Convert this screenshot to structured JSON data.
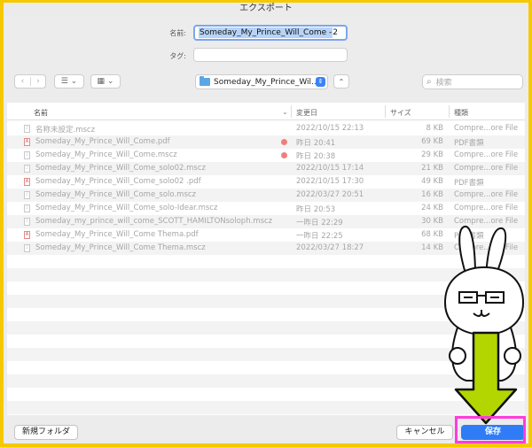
{
  "dialog": {
    "title": "エクスポート",
    "name_label": "名前:",
    "name_value": "Someday_My_Prince_Will_Come - ",
    "name_tail": "2",
    "tag_label": "タグ:",
    "location": "Someday_My_Prince_Wil...",
    "search_placeholder": "検索"
  },
  "toolbar": {
    "back_glyph": "‹",
    "forward_glyph": "›",
    "list_view_glyph": "☰ ⌄",
    "grid_view_glyph": "▦ ⌄",
    "expand_glyph": "⌃",
    "search_glyph": "⌕",
    "updown_glyph": "⇕"
  },
  "columns": {
    "name": "名前",
    "date": "変更日",
    "size": "サイズ",
    "kind": "種類",
    "chevron": "⌄"
  },
  "files": [
    {
      "icon": "score-file-icon",
      "name": "名称未設定.mscz",
      "date": "2022/10/15 22:13",
      "size": "8 KB",
      "kind": "Compre...ore File",
      "tag": false
    },
    {
      "icon": "pdf-file-icon",
      "name": "Someday_My_Prince_Will_Come.pdf",
      "date": "昨日 20:41",
      "size": "69 KB",
      "kind": "PDF書類",
      "tag": true
    },
    {
      "icon": "score-file-icon",
      "name": "Someday_My_Prince_Will_Come.mscz",
      "date": "昨日 20:38",
      "size": "29 KB",
      "kind": "Compre...ore File",
      "tag": true
    },
    {
      "icon": "score-file-icon",
      "name": "Someday_My_Prince_Will_Come_solo02.mscz",
      "date": "2022/10/15 17:14",
      "size": "21 KB",
      "kind": "Compre...ore File",
      "tag": false
    },
    {
      "icon": "pdf-file-icon",
      "name": "Someday_My_Prince_Will_Come_solo02 .pdf",
      "date": "2022/10/15 17:30",
      "size": "49 KB",
      "kind": "PDF書類",
      "tag": false
    },
    {
      "icon": "score-file-icon",
      "name": "Someday_My_Prince_Will_Come_solo.mscz",
      "date": "2022/03/27 20:51",
      "size": "16 KB",
      "kind": "Compre...ore File",
      "tag": false
    },
    {
      "icon": "score-file-icon",
      "name": "Someday_My_Prince_Will_Come_solo-Idear.mscz",
      "date": "昨日 20:53",
      "size": "24 KB",
      "kind": "Compre...ore File",
      "tag": false
    },
    {
      "icon": "score-file-icon",
      "name": "Someday_my_prince_will_come_SCOTT_HAMILTONsoloph.mscz",
      "date": "一昨日 22:29",
      "size": "30 KB",
      "kind": "Compre...ore File",
      "tag": false
    },
    {
      "icon": "pdf-file-icon",
      "name": "Someday_My_Prince_Will_Come Thema.pdf",
      "date": "一昨日 22:25",
      "size": "68 KB",
      "kind": "PDF書類",
      "tag": false
    },
    {
      "icon": "score-file-icon",
      "name": "Someday_My_Prince_Will_Come Thema.mscz",
      "date": "2022/03/27 18:27",
      "size": "14 KB",
      "kind": "Compre...ore File",
      "tag": false
    }
  ],
  "buttons": {
    "new_folder": "新規フォルダ",
    "cancel": "キャンセル",
    "save": "保存"
  },
  "colors": {
    "frame": "#f5c800",
    "highlight": "#ff3cdc",
    "accent": "#2f7cf6",
    "arrow": "#b4d600",
    "tag_red": "#ef7f7f"
  }
}
